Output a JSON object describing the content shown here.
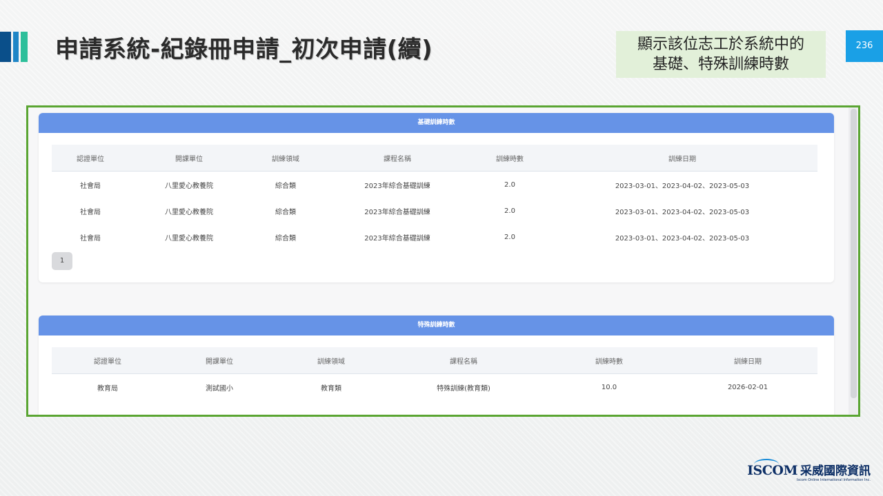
{
  "slide": {
    "title": "申請系統-紀錄冊申請_初次申請(續)",
    "note_line1": "顯示該位志工於系統中的",
    "note_line2": "基礎、特殊訓練時數",
    "page_number": "236"
  },
  "basic_panel": {
    "header": "基礎訓練時數",
    "columns": [
      "認證單位",
      "開課單位",
      "訓練領域",
      "課程名稱",
      "訓練時數",
      "訓練日期"
    ],
    "rows": [
      [
        "社會局",
        "八里愛心教養院",
        "綜合類",
        "2023年綜合基礎訓練",
        "2.0",
        "2023-03-01、2023-04-02、2023-05-03"
      ],
      [
        "社會局",
        "八里愛心教養院",
        "綜合類",
        "2023年綜合基礎訓練",
        "2.0",
        "2023-03-01、2023-04-02、2023-05-03"
      ],
      [
        "社會局",
        "八里愛心教養院",
        "綜合類",
        "2023年綜合基礎訓練",
        "2.0",
        "2023-03-01、2023-04-02、2023-05-03"
      ]
    ],
    "pager_current": "1"
  },
  "special_panel": {
    "header": "特殊訓練時數",
    "columns": [
      "認證單位",
      "開課單位",
      "訓練領域",
      "課程名稱",
      "訓練時數",
      "訓練日期"
    ],
    "rows": [
      [
        "教育局",
        "測試國小",
        "教育類",
        "特殊訓練(教育類)",
        "10.0",
        "2026-02-01"
      ]
    ]
  },
  "logo": {
    "mark": "ISCOM",
    "chinese": "采威國際資訊",
    "sub": "Iscom Online International Information Inc."
  },
  "colors": {
    "panel_header": "#6693e7",
    "frame_border": "#5aa532",
    "note_bg": "#e2f0d9",
    "page_badge": "#1aa0e6"
  }
}
